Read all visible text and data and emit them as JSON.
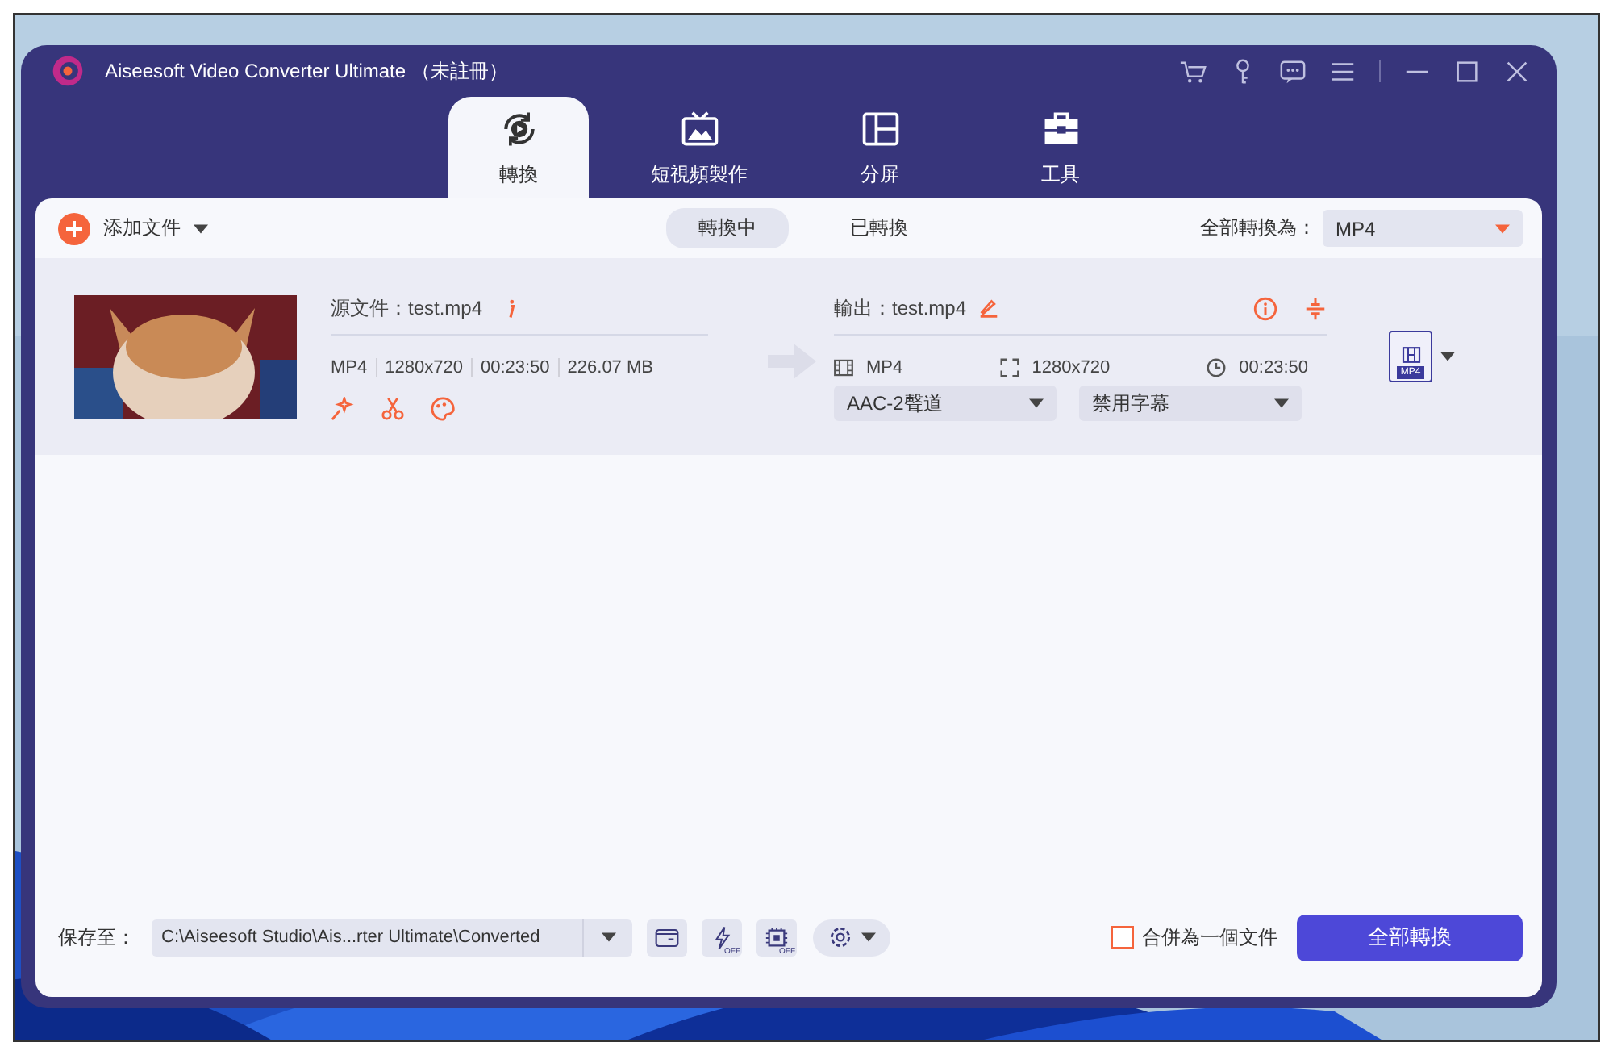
{
  "window": {
    "title": "Aiseesoft Video Converter Ultimate （未註冊）"
  },
  "tabs": [
    {
      "label": "轉換",
      "selected": true,
      "kind": "convert"
    },
    {
      "label": "短視頻製作",
      "selected": false,
      "kind": "mv"
    },
    {
      "label": "分屏",
      "selected": false,
      "kind": "collage"
    },
    {
      "label": "工具",
      "selected": false,
      "kind": "toolbox"
    }
  ],
  "toolbar": {
    "add_label": "添加文件",
    "segments": [
      {
        "label": "轉換中",
        "selected": true
      },
      {
        "label": "已轉換",
        "selected": false
      }
    ],
    "convert_all_label": "全部轉換為：",
    "format": "MP4"
  },
  "files": [
    {
      "source": "源文件：test.mp4",
      "meta": [
        "MP4",
        "1280x720",
        "00:23:50",
        "226.07 MB"
      ],
      "output": "輸出：test.mp4",
      "out_format": "MP4",
      "out_resolution": "1280x720",
      "out_duration": "00:23:50",
      "audio": "AAC-2聲道",
      "subtitle": "禁用字幕",
      "badge": "MP4"
    }
  ],
  "bottom": {
    "save_label": "保存至：",
    "path": "C:\\Aiseesoft Studio\\Ais...rter Ultimate\\Converted",
    "accel_label": "OFF",
    "gpu_label": "OFF",
    "merge": {
      "label": "合併為一個文件",
      "checked": false
    },
    "convert_button": "全部轉換"
  }
}
